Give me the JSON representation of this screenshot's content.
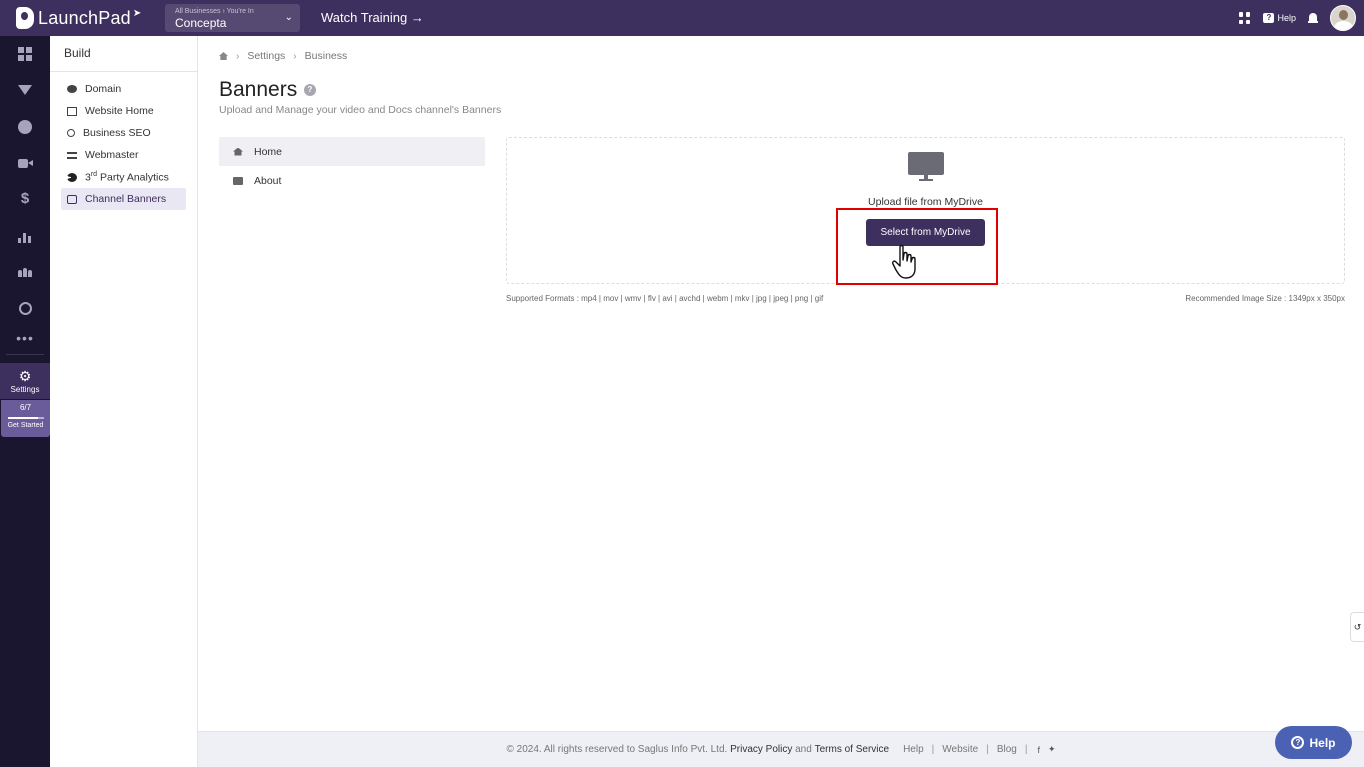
{
  "topbar": {
    "brand": "LaunchPad",
    "biz_crumb": "All Businesses › You're In",
    "biz_name": "Concepta",
    "watch_training": "Watch Training →",
    "help_label": "Help"
  },
  "rail": {
    "settings_label": "Settings",
    "progress_text": "6/7",
    "progress_fraction": 0.857,
    "get_started_label": "Get Started"
  },
  "subnav": {
    "title": "Build",
    "items": [
      {
        "label": "Domain",
        "icon": "domain-icon"
      },
      {
        "label": "Website Home",
        "icon": "website-icon"
      },
      {
        "label": "Business SEO",
        "icon": "seo-icon"
      },
      {
        "label": "Webmaster",
        "icon": "webmaster-icon"
      },
      {
        "label_pre": "3",
        "label_sup": "rd",
        "label_post": " Party Analytics",
        "icon": "analytics-icon"
      },
      {
        "label": "Channel Banners",
        "icon": "banner-icon",
        "active": true
      }
    ]
  },
  "breadcrumb": [
    "Settings",
    "Business"
  ],
  "page": {
    "title": "Banners",
    "subtitle": "Upload and Manage your video and Docs channel's Banners"
  },
  "tabs": [
    {
      "label": "Home",
      "active": true
    },
    {
      "label": "About",
      "active": false
    }
  ],
  "upload": {
    "label": "Upload file from MyDrive",
    "button": "Select from MyDrive",
    "formats": "Supported Formats : mp4 | mov | wmv | flv | avi | avchd | webm | mkv | jpg | jpeg | png | gif",
    "recommended": "Recommended Image Size : 1349px x 350px"
  },
  "footer": {
    "copyright": "©  2024. All rights reserved to Saglus Info Pvt. Ltd.",
    "privacy": "Privacy Policy",
    "and": "and",
    "terms": "Terms of Service",
    "help": "Help",
    "website": "Website",
    "blog": "Blog"
  },
  "help_float": "Help",
  "colors": {
    "brand": "#3d2f5e",
    "rail": "#1b1630",
    "highlight": "#e00000",
    "help_button": "#4b62b4"
  }
}
